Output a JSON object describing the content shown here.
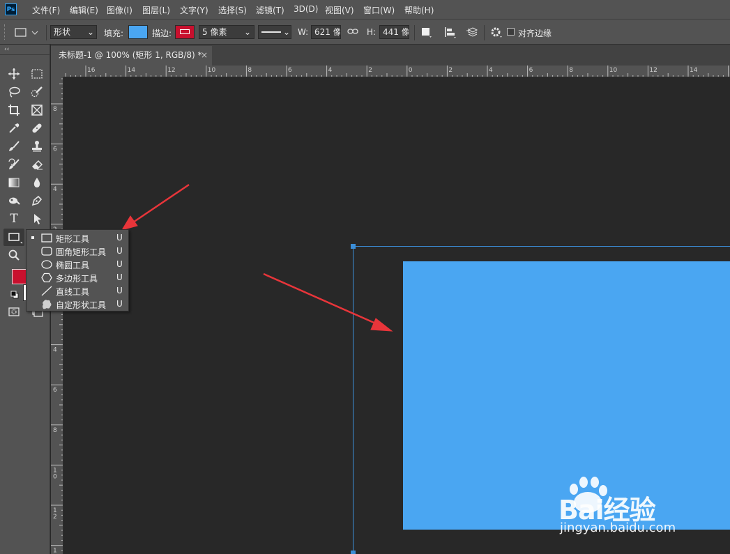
{
  "app": {
    "logo_text": "Ps"
  },
  "menu": [
    "文件(F)",
    "编辑(E)",
    "图像(I)",
    "图层(L)",
    "文字(Y)",
    "选择(S)",
    "滤镜(T)",
    "3D(D)",
    "视图(V)",
    "窗口(W)",
    "帮助(H)"
  ],
  "options": {
    "mode_value": "形状",
    "fill_label": "填充:",
    "fill_color": "#4aa6f2",
    "stroke_label": "描边:",
    "stroke_color": "#c8102e",
    "stroke_width": "5 像素",
    "w_label": "W:",
    "w_value": "621 像",
    "h_label": "H:",
    "h_value": "441 像",
    "align_edges_label": "对齐边缘"
  },
  "document": {
    "tab_title": "未标题-1 @ 100% (矩形 1, RGB/8) *",
    "close_glyph": "×"
  },
  "ruler": {
    "top_labels": [
      "16",
      "14",
      "12",
      "10",
      "8",
      "6",
      "4",
      "2",
      "0",
      "2",
      "4",
      "6",
      "8",
      "10",
      "12",
      "14"
    ],
    "left_labels": [
      "8",
      "6",
      "4",
      "2",
      "0",
      "2",
      "4",
      "6",
      "8",
      "1\n0",
      "1\n2",
      "1\n4"
    ]
  },
  "colors": {
    "foreground": "#c8102e",
    "shape_fill": "#4aa6f2",
    "path_outline": "#3b8ed8",
    "arrow": "#e8353a"
  },
  "flyout": [
    {
      "label": "矩形工具",
      "key": "U",
      "icon": "rectangle-icon",
      "active": true
    },
    {
      "label": "圆角矩形工具",
      "key": "U",
      "icon": "rounded-rectangle-icon",
      "active": false
    },
    {
      "label": "椭圆工具",
      "key": "U",
      "icon": "ellipse-icon",
      "active": false
    },
    {
      "label": "多边形工具",
      "key": "U",
      "icon": "polygon-icon",
      "active": false
    },
    {
      "label": "直线工具",
      "key": "U",
      "icon": "line-icon",
      "active": false
    },
    {
      "label": "自定形状工具",
      "key": "U",
      "icon": "custom-shape-icon",
      "active": false
    }
  ],
  "watermark": {
    "brand": "Bai经验",
    "url": "jingyan.baidu.com"
  }
}
